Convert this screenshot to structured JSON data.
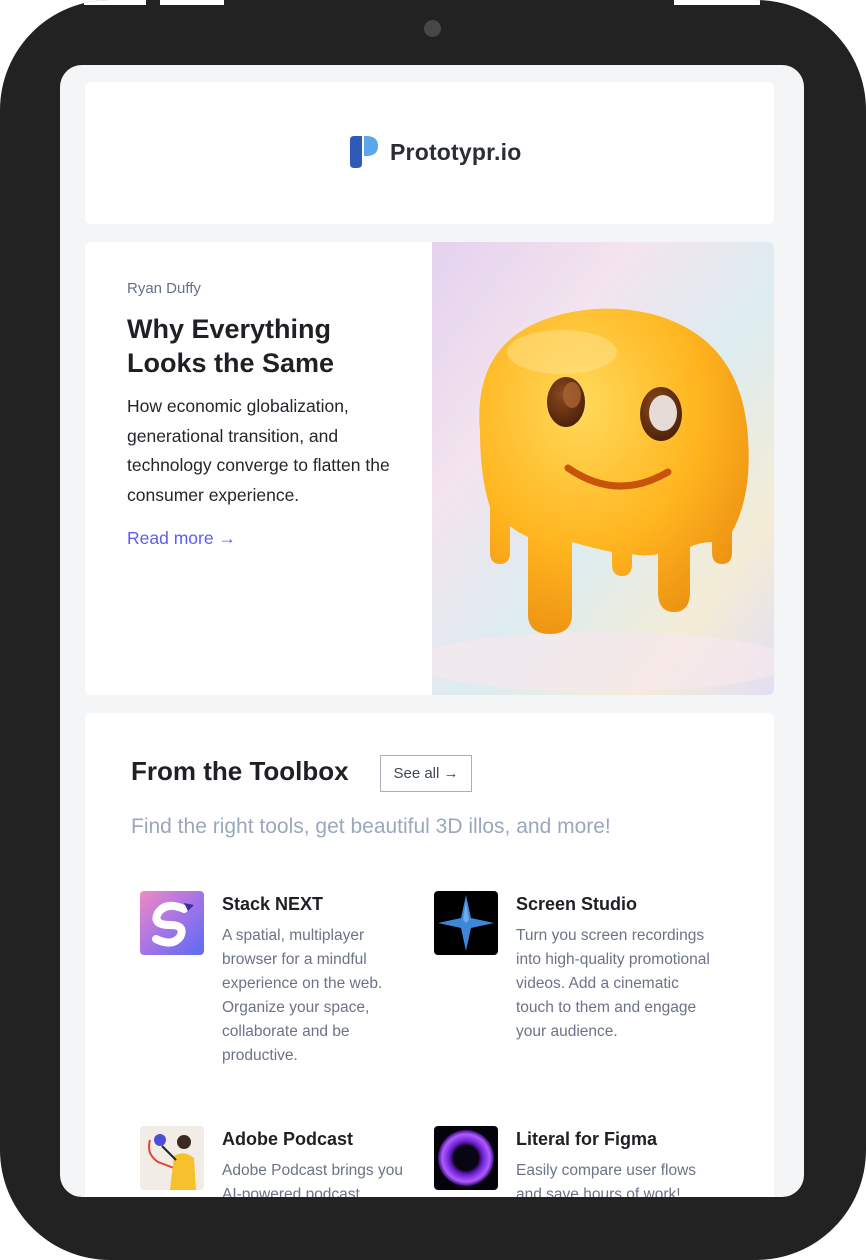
{
  "brand": {
    "name": "Prototypr.io",
    "color_dark": "#2d5bb8",
    "color_light": "#5aa7ea"
  },
  "article": {
    "author": "Ryan Duffy",
    "title": "Why Everything Looks the Same",
    "description": "How economic globalization, generational transition, and technology converge to flatten the consumer experience.",
    "read_more": "Read more →",
    "image_icon": "melting-smiley-illustration"
  },
  "toolbox": {
    "title": "From the Toolbox",
    "see_all": "See all →",
    "subtitle": "Find the right tools, get beautiful 3D illos, and more!",
    "tools": [
      {
        "name": "Stack NEXT",
        "description": "A spatial, multiplayer browser for a mindful experience on the web. Organize your space, collaborate and be productive.",
        "icon": "stack-next-icon"
      },
      {
        "name": "Screen Studio",
        "description": "Turn you screen recordings into high-quality promotional videos. Add a cinematic touch to them and engage your audience.",
        "icon": "screen-studio-icon"
      },
      {
        "name": "Adobe Podcast",
        "description": "Adobe Podcast brings you AI-powered podcast",
        "icon": "adobe-podcast-icon"
      },
      {
        "name": "Literal for Figma",
        "description": "Easily compare user flows and save hours of work!",
        "icon": "literal-figma-icon"
      }
    ]
  },
  "colors": {
    "accent": "#5b5ef0",
    "frame": "#222222",
    "background": "#f4f5f7"
  }
}
